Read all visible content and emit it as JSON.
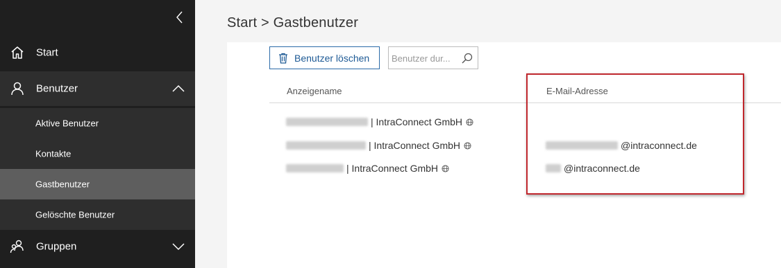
{
  "sidebar": {
    "collapse_icon": "chevron-left-icon",
    "items": [
      {
        "label": "Start",
        "icon": "home-icon"
      },
      {
        "label": "Benutzer",
        "icon": "person-icon",
        "expanded": true,
        "children": [
          {
            "label": "Aktive Benutzer"
          },
          {
            "label": "Kontakte"
          },
          {
            "label": "Gastbenutzer",
            "active": true
          },
          {
            "label": "Gelöschte Benutzer"
          }
        ]
      },
      {
        "label": "Gruppen",
        "icon": "group-icon",
        "expanded": false
      }
    ]
  },
  "breadcrumb": "Start > Gastbenutzer",
  "toolbar": {
    "delete_label": "Benutzer löschen",
    "delete_icon": "trash-icon",
    "search_placeholder": "Benutzer dur...",
    "search_icon": "search-icon"
  },
  "table": {
    "columns": [
      "Anzeigename",
      "E-Mail-Adresse"
    ],
    "rows": [
      {
        "name_suffix": "| IntraConnect GmbH",
        "email": ""
      },
      {
        "name_suffix": "| IntraConnect GmbH",
        "email": "@intraconnect.de"
      },
      {
        "name_suffix": "| IntraConnect GmbH",
        "email": "@intraconnect.de"
      }
    ]
  },
  "colors": {
    "sidebar_bg": "#1f1f1f",
    "active_item": "#5e5e5e",
    "accent": "#2b6aa8",
    "highlight": "#c0272d"
  }
}
